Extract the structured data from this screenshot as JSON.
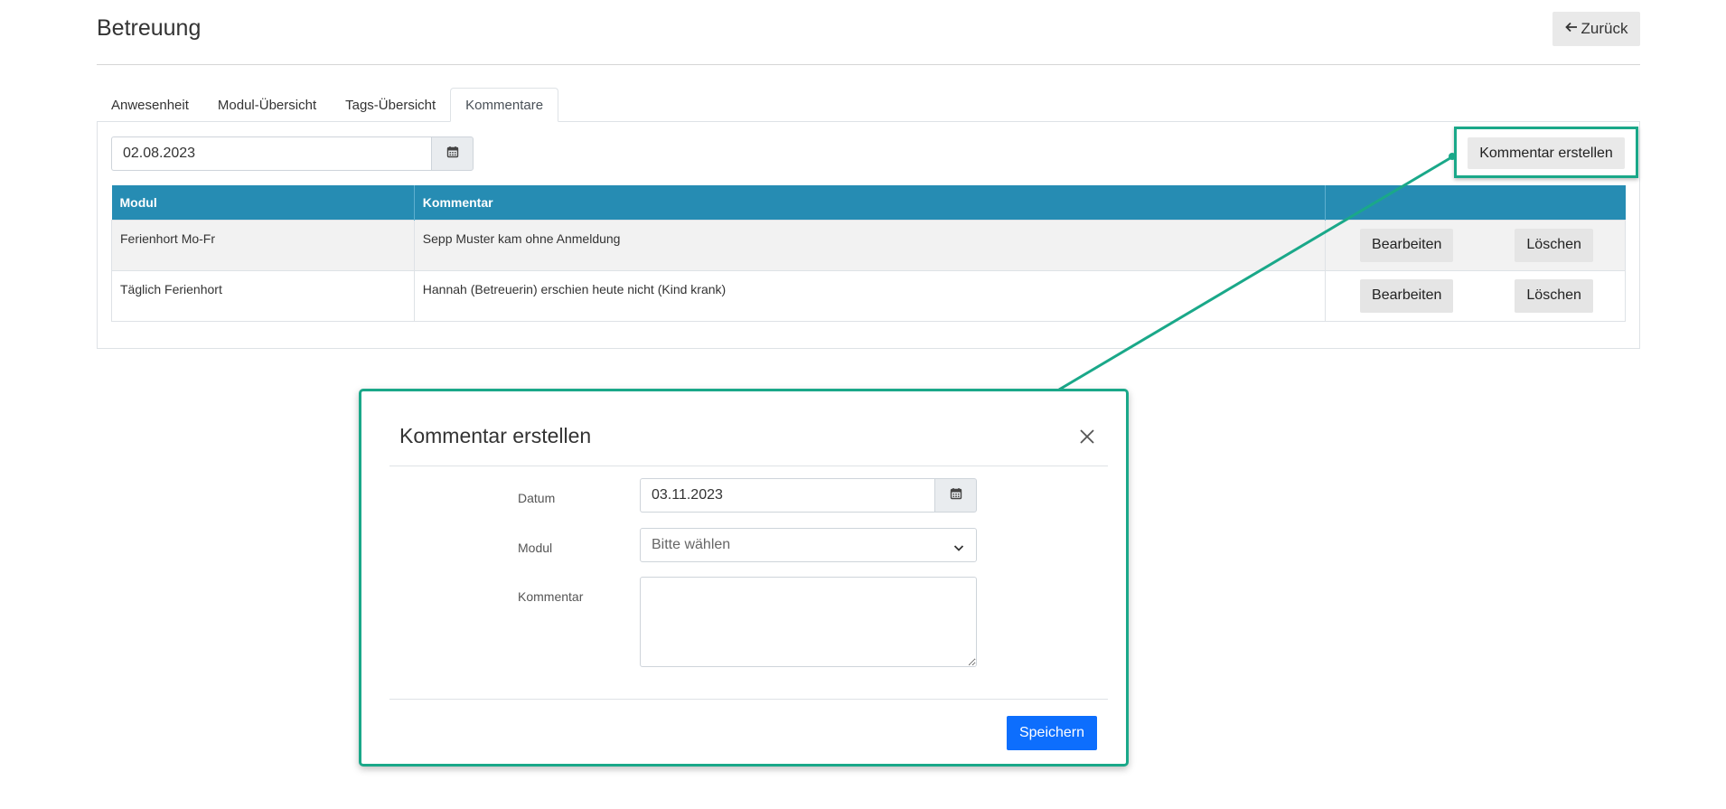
{
  "header": {
    "title": "Betreuung",
    "back_label": "Zurück",
    "back_icon": "arrow-left-icon"
  },
  "tabs": [
    {
      "label": "Anwesenheit",
      "active": false
    },
    {
      "label": "Modul-Übersicht",
      "active": false
    },
    {
      "label": "Tags-Übersicht",
      "active": false
    },
    {
      "label": "Kommentare",
      "active": true
    }
  ],
  "filter": {
    "date_value": "02.08.2023",
    "calendar_icon": "calendar-icon"
  },
  "create_button_label": "Kommentar erstellen",
  "table": {
    "columns": [
      "Modul",
      "Kommentar",
      ""
    ],
    "rows": [
      {
        "modul": "Ferienhort Mo-Fr",
        "kommentar": "Sepp Muster kam ohne Anmeldung",
        "edit_label": "Bearbeiten",
        "delete_label": "Löschen"
      },
      {
        "modul": "Täglich Ferienhort",
        "kommentar": "Hannah (Betreuerin) erschien heute nicht (Kind krank)",
        "edit_label": "Bearbeiten",
        "delete_label": "Löschen"
      }
    ]
  },
  "modal": {
    "title": "Kommentar erstellen",
    "close_icon": "close-icon",
    "date_label": "Datum",
    "date_value": "03.11.2023",
    "modul_label": "Modul",
    "modul_placeholder": "Bitte wählen",
    "kommentar_label": "Kommentar",
    "kommentar_value": "",
    "save_label": "Speichern"
  },
  "colors": {
    "table_header": "#268cb3",
    "highlight": "#1aa889",
    "primary": "#0d6efd"
  }
}
